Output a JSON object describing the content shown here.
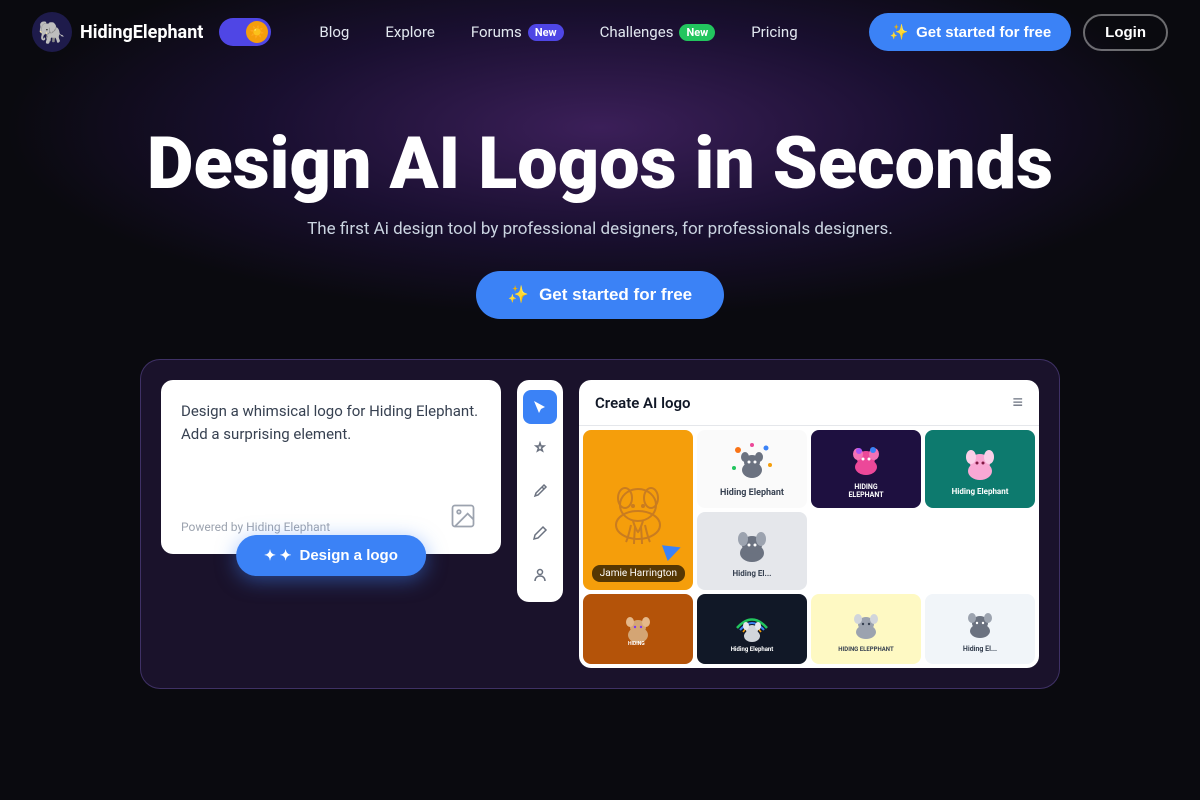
{
  "nav": {
    "logo_text": "HidingElephant",
    "links": [
      {
        "id": "blog",
        "label": "Blog",
        "badge": null
      },
      {
        "id": "explore",
        "label": "Explore",
        "badge": null
      },
      {
        "id": "forums",
        "label": "Forums",
        "badge": "New",
        "badge_type": "blue"
      },
      {
        "id": "challenges",
        "label": "Challenges",
        "badge": "New",
        "badge_type": "green"
      },
      {
        "id": "pricing",
        "label": "Pricing",
        "badge": null
      }
    ],
    "cta_label": "Get started for free",
    "login_label": "Login"
  },
  "hero": {
    "title": "Design AI Logos in Seconds",
    "subtitle": "The first Ai design tool by professional designers, for professionals designers.",
    "cta_label": "Get started for free"
  },
  "preview": {
    "prompt_text": "Design a whimsical logo for Hiding Elephant. Add a surprising element.",
    "powered_by": "Powered by Hiding Elephant",
    "design_btn_label": "Design a logo",
    "right_panel_title": "Create AI logo",
    "user_badge": "Jamie Harrington"
  },
  "tools": [
    {
      "id": "cursor",
      "icon": "▷",
      "active": true
    },
    {
      "id": "magic",
      "icon": "✦",
      "active": false
    },
    {
      "id": "pen",
      "icon": "✏",
      "active": false
    },
    {
      "id": "pencil",
      "icon": "✍",
      "active": false
    },
    {
      "id": "person",
      "icon": "☺",
      "active": false
    }
  ],
  "colors": {
    "brand_blue": "#3b82f6",
    "brand_purple": "#4f46e5",
    "nav_bg": "#0a0a0f"
  }
}
